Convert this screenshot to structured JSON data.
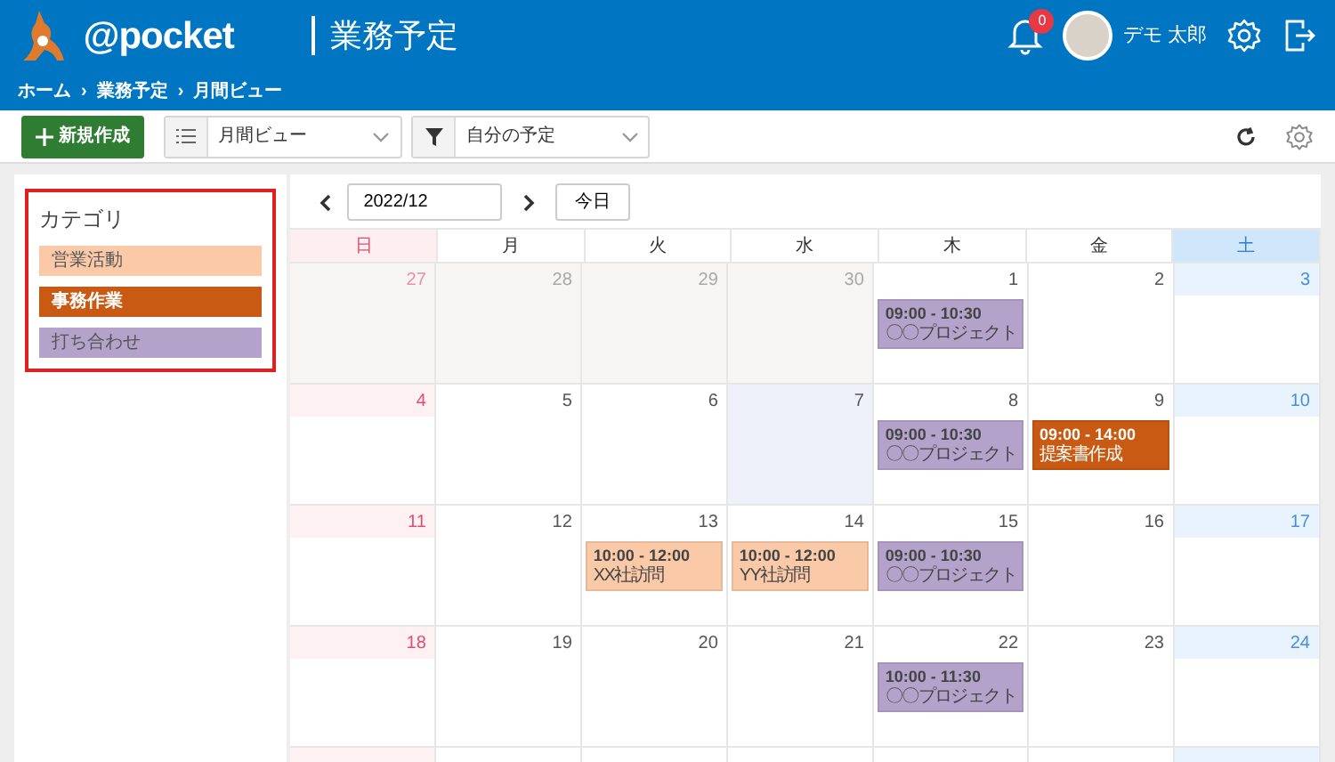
{
  "header": {
    "logo_text": "@pocket",
    "title": "業務予定",
    "notification_count": "0",
    "user_name": "デモ 太郎"
  },
  "breadcrumb": {
    "items": [
      "ホーム",
      "業務予定",
      "月間ビュー"
    ],
    "separator": "›"
  },
  "toolbar": {
    "new_button": "新規作成",
    "view_select": "月間ビュー",
    "filter_select": "自分の予定"
  },
  "categories": {
    "title": "カテゴリ",
    "items": [
      {
        "name": "営業活動",
        "color": "#f9c9a8"
      },
      {
        "name": "事務作業",
        "color": "#c85a14"
      },
      {
        "name": "打ち合わせ",
        "color": "#b3a2c9"
      }
    ]
  },
  "calendar": {
    "month": "2022/12",
    "today_button": "今日",
    "weekdays": [
      {
        "label": "日",
        "kind": "sun"
      },
      {
        "label": "月",
        "kind": "weekday"
      },
      {
        "label": "火",
        "kind": "weekday"
      },
      {
        "label": "水",
        "kind": "weekday"
      },
      {
        "label": "木",
        "kind": "weekday"
      },
      {
        "label": "金",
        "kind": "weekday"
      },
      {
        "label": "土",
        "kind": "sat"
      }
    ],
    "weeks": [
      {
        "days": [
          {
            "day": "27",
            "kind": "other"
          },
          {
            "day": "28",
            "kind": "other"
          },
          {
            "day": "29",
            "kind": "other"
          },
          {
            "day": "30",
            "kind": "other"
          },
          {
            "day": "1",
            "kind": "current",
            "events": [
              {
                "time": "09:00 - 10:30",
                "title": "〇〇プロジェクト",
                "color": "#b3a2c9"
              }
            ]
          },
          {
            "day": "2",
            "kind": "current"
          },
          {
            "day": "3",
            "kind": "current"
          }
        ]
      },
      {
        "days": [
          {
            "day": "4",
            "kind": "current"
          },
          {
            "day": "5",
            "kind": "current"
          },
          {
            "day": "6",
            "kind": "current"
          },
          {
            "day": "7",
            "kind": "today"
          },
          {
            "day": "8",
            "kind": "current",
            "events": [
              {
                "time": "09:00 - 10:30",
                "title": "〇〇プロジェクト",
                "color": "#b3a2c9"
              }
            ]
          },
          {
            "day": "9",
            "kind": "current",
            "events": [
              {
                "time": "09:00 - 14:00",
                "title": "提案書作成",
                "color": "#c85a14"
              }
            ]
          },
          {
            "day": "10",
            "kind": "current"
          }
        ]
      },
      {
        "days": [
          {
            "day": "11",
            "kind": "current"
          },
          {
            "day": "12",
            "kind": "current"
          },
          {
            "day": "13",
            "kind": "current",
            "events": [
              {
                "time": "10:00 - 12:00",
                "title": "XX社訪問",
                "color": "#f9c9a8"
              }
            ]
          },
          {
            "day": "14",
            "kind": "current",
            "events": [
              {
                "time": "10:00 - 12:00",
                "title": "YY社訪問",
                "color": "#f9c9a8"
              }
            ]
          },
          {
            "day": "15",
            "kind": "current",
            "events": [
              {
                "time": "09:00 - 10:30",
                "title": "〇〇プロジェクト",
                "color": "#b3a2c9"
              }
            ]
          },
          {
            "day": "16",
            "kind": "current"
          },
          {
            "day": "17",
            "kind": "current"
          }
        ]
      },
      {
        "days": [
          {
            "day": "18",
            "kind": "current"
          },
          {
            "day": "19",
            "kind": "current"
          },
          {
            "day": "20",
            "kind": "current"
          },
          {
            "day": "21",
            "kind": "current"
          },
          {
            "day": "22",
            "kind": "current",
            "events": [
              {
                "time": "10:00 - 11:30",
                "title": "〇〇プロジェクト",
                "color": "#b3a2c9"
              }
            ]
          },
          {
            "day": "23",
            "kind": "current"
          },
          {
            "day": "24",
            "kind": "current"
          }
        ]
      },
      {
        "days": [
          {
            "kind": "current"
          },
          {
            "kind": "current"
          },
          {
            "kind": "current"
          },
          {
            "kind": "current"
          },
          {
            "kind": "current"
          },
          {
            "kind": "current"
          },
          {
            "kind": "current"
          }
        ]
      }
    ]
  }
}
